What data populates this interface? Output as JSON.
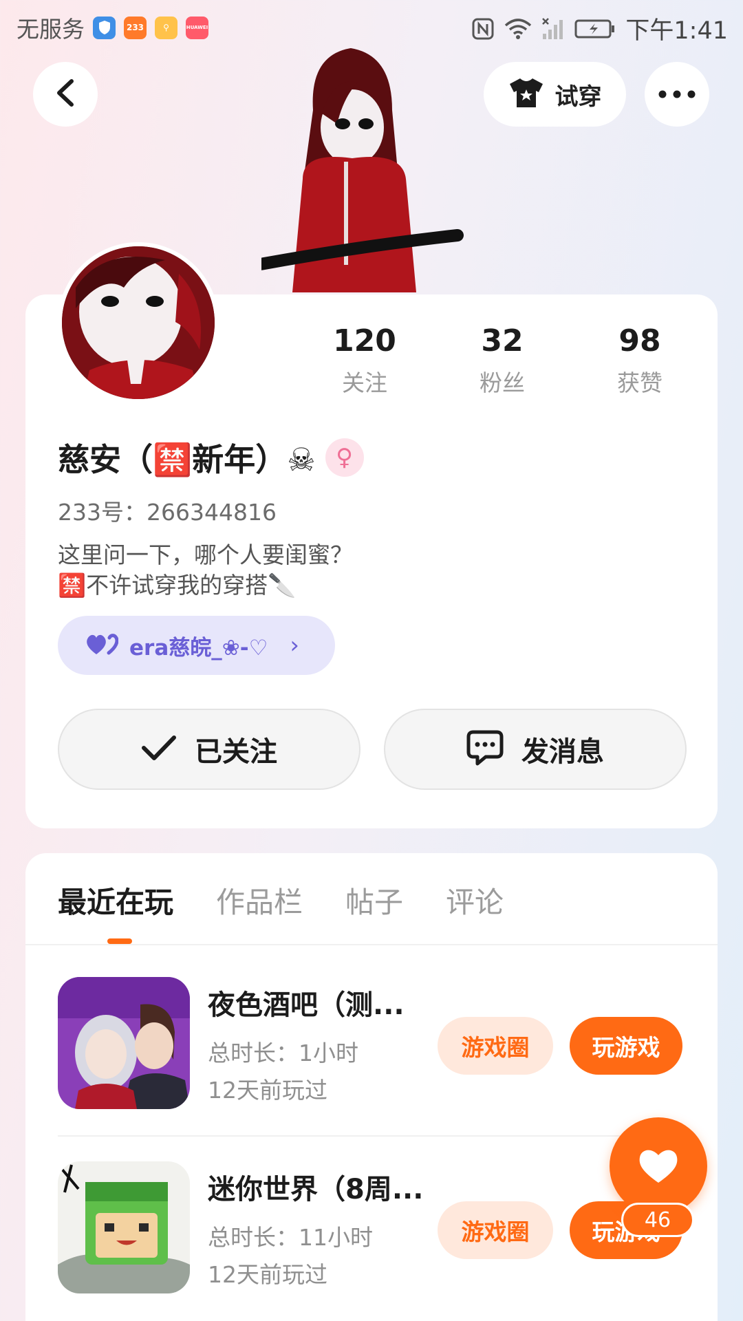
{
  "status_bar": {
    "carrier": "无服务",
    "app_badges": [
      "233",
      "HUAWEI"
    ],
    "time": "下午1:41"
  },
  "top_bar": {
    "try_on_label": "试穿"
  },
  "profile": {
    "stats": [
      {
        "value": "120",
        "label": "关注"
      },
      {
        "value": "32",
        "label": "粉丝"
      },
      {
        "value": "98",
        "label": "获赞"
      }
    ],
    "name": "慈安（🈲新年）☠",
    "gender": "♀",
    "uid": "233号：266344816",
    "bio_line1": "这里问一下，哪个人要闺蜜？",
    "bio_line2": "🈲不许试穿我的穿搭🔪",
    "tag_text": "era慈皖_❀-♡",
    "tag_arrow": "›",
    "followed_label": "已关注",
    "message_label": "发消息"
  },
  "tabs": [
    {
      "label": "最近在玩",
      "active": true
    },
    {
      "label": "作品栏",
      "active": false
    },
    {
      "label": "帖子",
      "active": false
    },
    {
      "label": "评论",
      "active": false
    }
  ],
  "games": [
    {
      "title": "夜色酒吧（测...",
      "duration": "总时长：1小时",
      "last_played": "12天前玩过",
      "circle_label": "游戏圈",
      "play_label": "玩游戏"
    },
    {
      "title": "迷你世界（8周...",
      "duration": "总时长：11小时",
      "last_played": "12天前玩过",
      "circle_label": "游戏圈",
      "play_label": "玩游戏"
    }
  ],
  "like_count": "46",
  "colors": {
    "accent": "#ff6a14",
    "accent_light": "#ffe8dc",
    "tag_bg": "#e7e6fb",
    "tag_text": "#6a5fd6"
  }
}
